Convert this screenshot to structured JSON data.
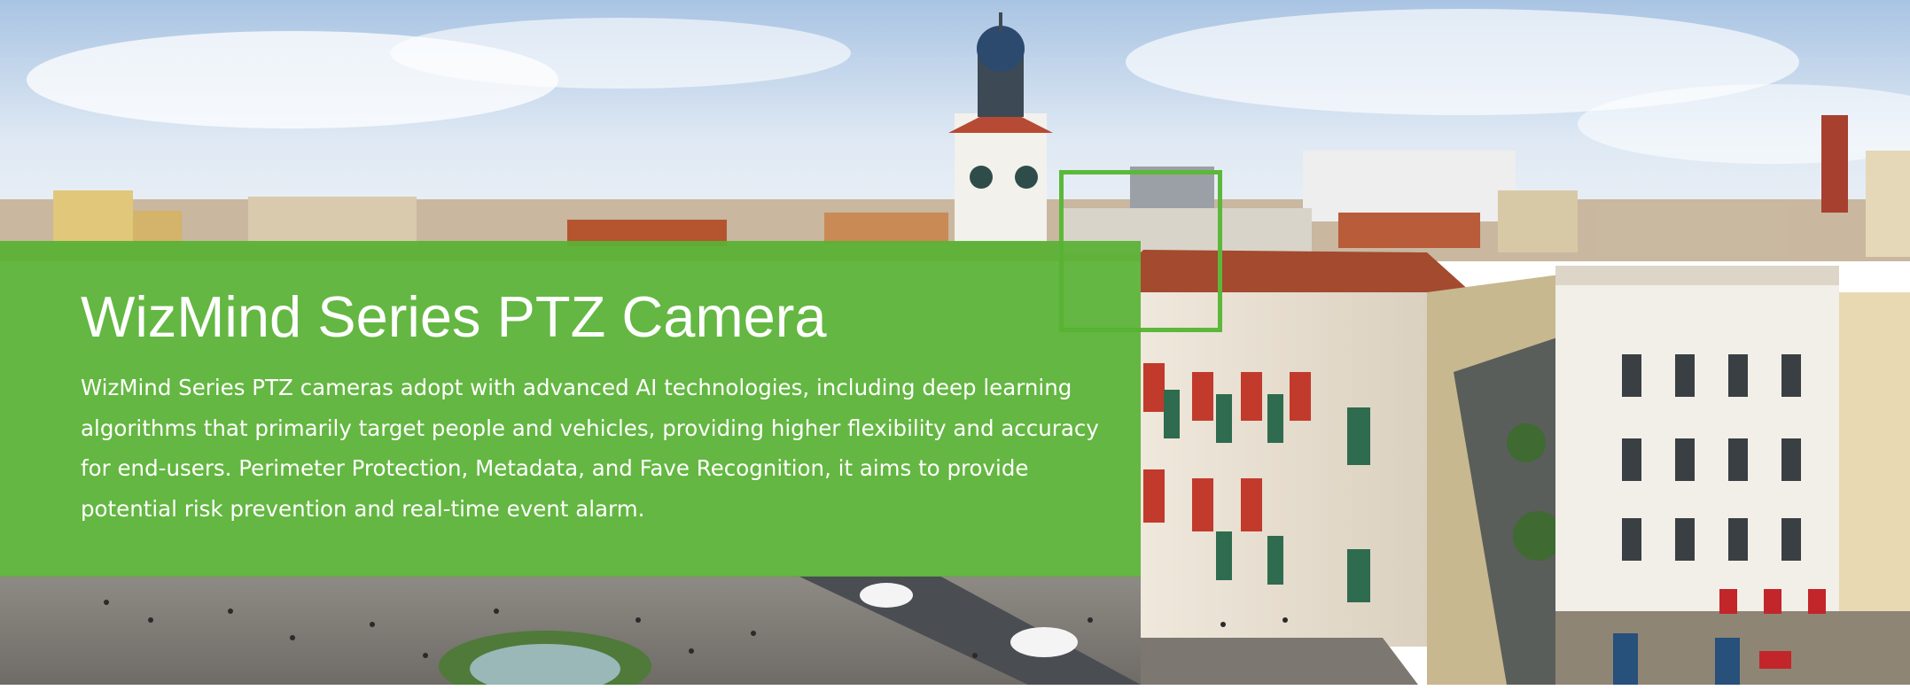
{
  "hero": {
    "title": "WizMind Series PTZ Camera",
    "description": "WizMind Series PTZ cameras adopt with advanced AI technologies, including deep learning algorithms that primarily target people and vehicles, providing higher flexibility and accuracy for end-users. Perimeter Protection, Metadata, and Fave Recognition, it aims to provide potential risk prevention and real-time event alarm."
  },
  "colors": {
    "brand_green": "#58b234",
    "bracket_green": "#5cb83a",
    "text": "#ffffff"
  }
}
